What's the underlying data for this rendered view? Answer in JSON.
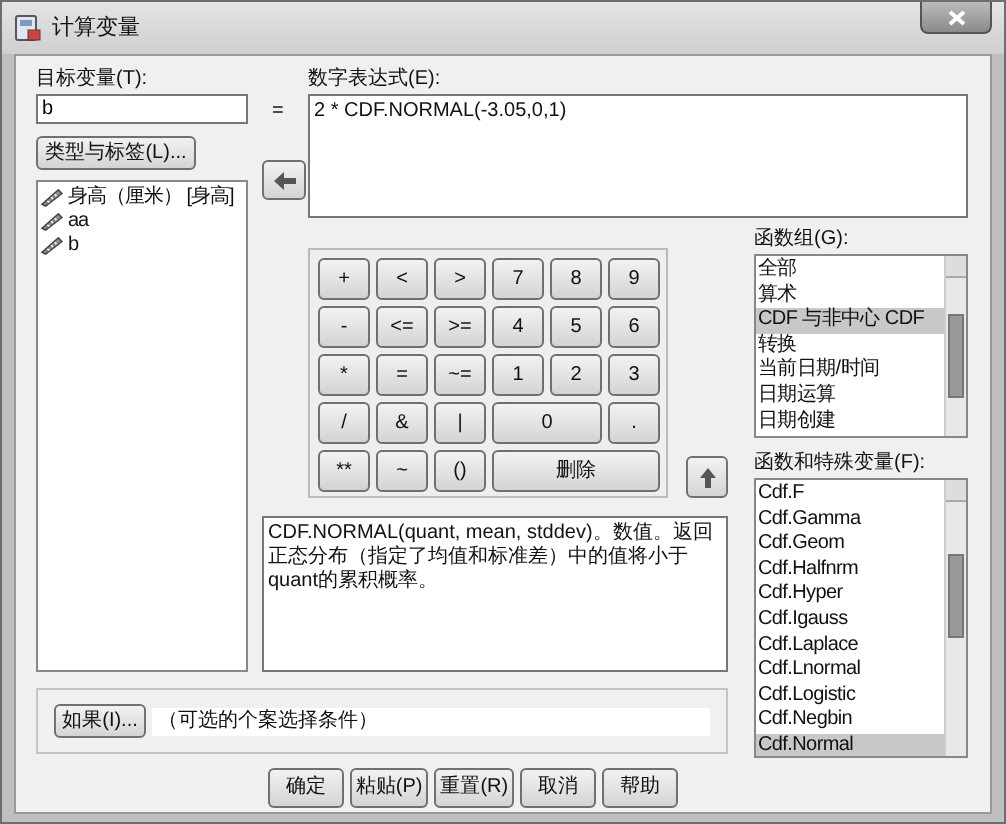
{
  "window": {
    "title": "计算变量"
  },
  "target": {
    "label": "目标变量(T):",
    "value": "b"
  },
  "equals": "=",
  "type_label_button": "类型与标签(L)...",
  "variables": [
    {
      "name": "身高（厘米） [身高]"
    },
    {
      "name": "aa"
    },
    {
      "name": "b"
    }
  ],
  "expression": {
    "label": "数字表达式(E):",
    "value": "2 * CDF.NORMAL(-3.05,0,1)"
  },
  "keypad": [
    {
      "label": "+",
      "kind": "key"
    },
    {
      "label": "<",
      "kind": "key"
    },
    {
      "label": ">",
      "kind": "key"
    },
    {
      "label": "7",
      "kind": "key"
    },
    {
      "label": "8",
      "kind": "key"
    },
    {
      "label": "9",
      "kind": "key"
    },
    {
      "label": "-",
      "kind": "key"
    },
    {
      "label": "<=",
      "kind": "key"
    },
    {
      "label": ">=",
      "kind": "key"
    },
    {
      "label": "4",
      "kind": "key"
    },
    {
      "label": "5",
      "kind": "key"
    },
    {
      "label": "6",
      "kind": "key"
    },
    {
      "label": "*",
      "kind": "key"
    },
    {
      "label": "=",
      "kind": "key"
    },
    {
      "label": "~=",
      "kind": "key"
    },
    {
      "label": "1",
      "kind": "key"
    },
    {
      "label": "2",
      "kind": "key"
    },
    {
      "label": "3",
      "kind": "key"
    },
    {
      "label": "/",
      "kind": "key"
    },
    {
      "label": "&",
      "kind": "key"
    },
    {
      "label": "|",
      "kind": "key"
    },
    {
      "label": "0",
      "kind": "zero"
    },
    {
      "label": ".",
      "kind": "key"
    },
    {
      "label": "**",
      "kind": "key"
    },
    {
      "label": "~",
      "kind": "key"
    },
    {
      "label": "()",
      "kind": "key"
    },
    {
      "label": "删除",
      "kind": "delete"
    }
  ],
  "description": "CDF.NORMAL(quant, mean, stddev)。数值。返回正态分布（指定了均值和标准差）中的值将小于 quant的累积概率。",
  "function_groups": {
    "label": "函数组(G):",
    "items": [
      {
        "name": "全部",
        "selected": false
      },
      {
        "name": "算术",
        "selected": false
      },
      {
        "name": "CDF 与非中心 CDF",
        "selected": true
      },
      {
        "name": "转换",
        "selected": false
      },
      {
        "name": "当前日期/时间",
        "selected": false
      },
      {
        "name": "日期运算",
        "selected": false
      },
      {
        "name": "日期创建",
        "selected": false
      }
    ]
  },
  "functions": {
    "label": "函数和特殊变量(F):",
    "items": [
      {
        "name": "Cdf.F",
        "selected": false
      },
      {
        "name": "Cdf.Gamma",
        "selected": false
      },
      {
        "name": "Cdf.Geom",
        "selected": false
      },
      {
        "name": "Cdf.Halfnrm",
        "selected": false
      },
      {
        "name": "Cdf.Hyper",
        "selected": false
      },
      {
        "name": "Cdf.Igauss",
        "selected": false
      },
      {
        "name": "Cdf.Laplace",
        "selected": false
      },
      {
        "name": "Cdf.Lnormal",
        "selected": false
      },
      {
        "name": "Cdf.Logistic",
        "selected": false
      },
      {
        "name": "Cdf.Negbin",
        "selected": false
      },
      {
        "name": "Cdf.Normal",
        "selected": true
      }
    ]
  },
  "if_button": "如果(I)...",
  "condition_text": "（可选的个案选择条件）",
  "buttons": [
    "确定",
    "粘贴(P)",
    "重置(R)",
    "取消",
    "帮助"
  ]
}
